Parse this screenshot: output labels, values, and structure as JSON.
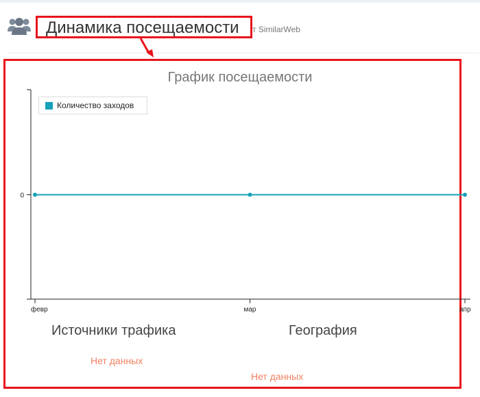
{
  "header": {
    "title": "Динамика посещаемости",
    "subtitle_fragment": "т SimilarWeb"
  },
  "chart": {
    "title": "График посещаемости",
    "legend_label": "Количество заходов",
    "series_color": "#17a2b8"
  },
  "chart_data": {
    "type": "line",
    "title": "График посещаемости",
    "categories": [
      "февр",
      "мар",
      "апр"
    ],
    "y_ticks": [
      "0"
    ],
    "series": [
      {
        "name": "Количество заходов",
        "values": [
          0,
          0,
          0
        ]
      }
    ],
    "legend_position": "top-left"
  },
  "sections": {
    "traffic_sources": {
      "title": "Источники трафика",
      "status": "Нет данных"
    },
    "geography": {
      "title": "География",
      "status": "Нет данных"
    }
  },
  "colors": {
    "highlight": "#e8141b",
    "no_data": "#f08060"
  }
}
